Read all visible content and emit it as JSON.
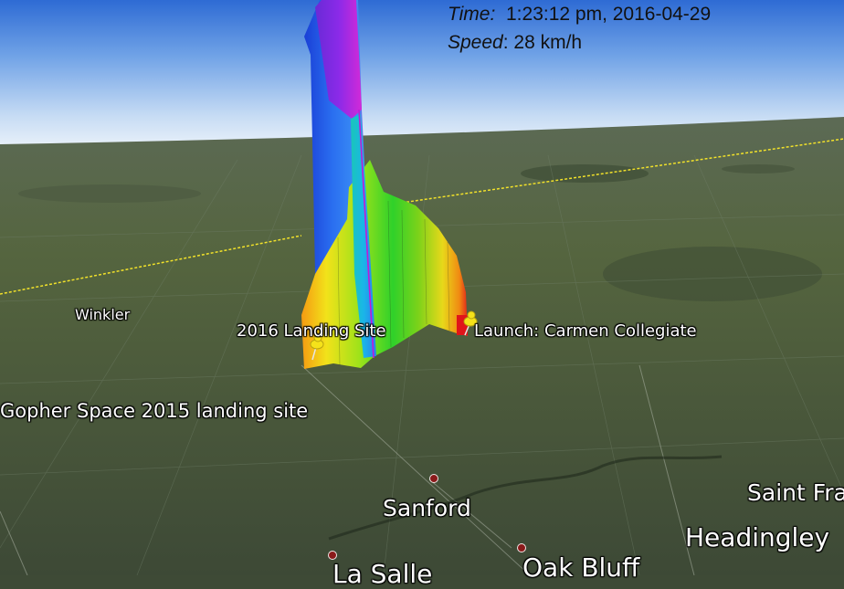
{
  "overlay": {
    "time_label": "Time:",
    "time_value": "1:23:12 pm, 2016-04-29",
    "speed_label": "Speed",
    "speed_value": ": 28 km/h"
  },
  "places": {
    "winkler": "Winkler",
    "landing_2016": "2016 Landing Site",
    "launch": "Launch: Carmen Collegiate",
    "gopher": "Gopher Space 2015 landing site",
    "sanford": "Sanford",
    "saint_francois": "Saint Fra",
    "headingley": "Headingley",
    "la_salle": "La Salle",
    "oak_bluff": "Oak Bluff"
  },
  "colors": {
    "sky_top": "#2f6fd6",
    "sky_horizon": "#eef4fb",
    "ground": "#4c5a41",
    "boundary_line": "#f2e22a",
    "town_dot": "#8a1a1a"
  },
  "icons": [
    "pushpin-icon",
    "town-dot-icon"
  ]
}
